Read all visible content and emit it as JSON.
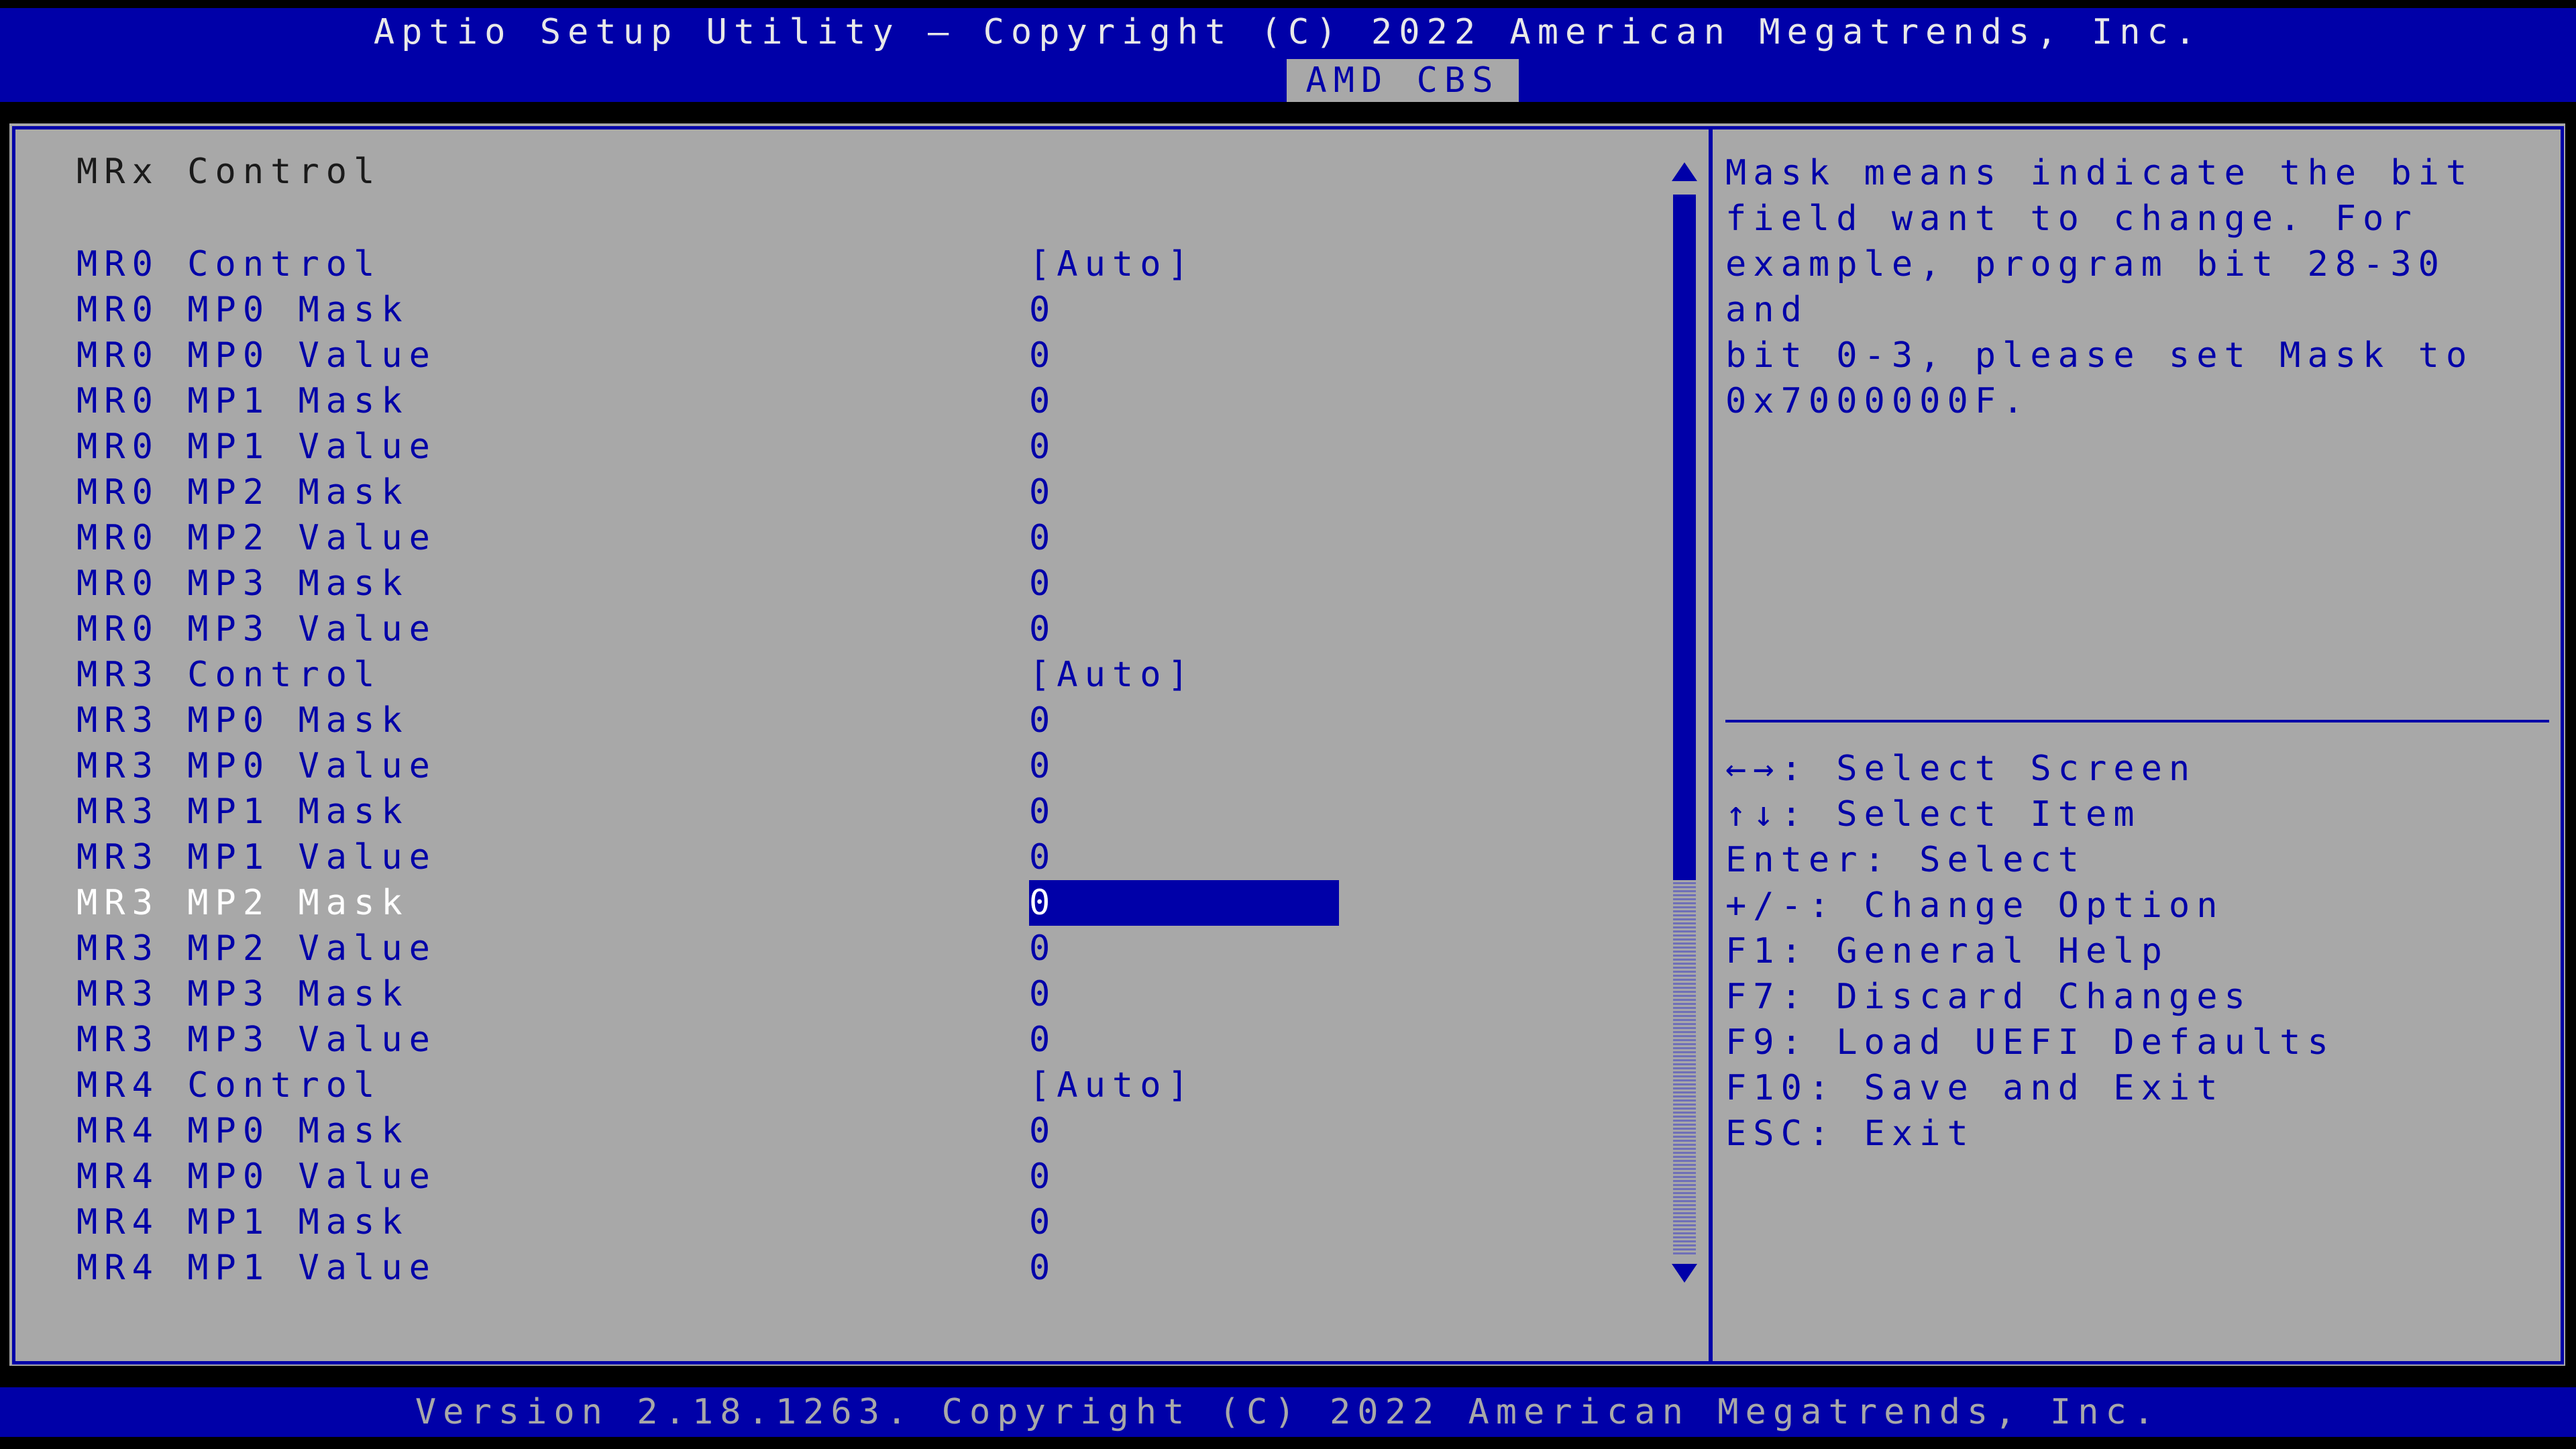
{
  "header": {
    "title": "Aptio Setup Utility – Copyright (C) 2022 American Megatrends, Inc.",
    "active_tab": "AMD CBS"
  },
  "menu": {
    "heading": "MRx Control",
    "items": [
      {
        "label": "MR0 Control",
        "value": "[Auto]"
      },
      {
        "label": "MR0 MP0 Mask",
        "value": "0"
      },
      {
        "label": "MR0 MP0 Value",
        "value": "0"
      },
      {
        "label": "MR0 MP1 Mask",
        "value": "0"
      },
      {
        "label": "MR0 MP1 Value",
        "value": "0"
      },
      {
        "label": "MR0 MP2 Mask",
        "value": "0"
      },
      {
        "label": "MR0 MP2 Value",
        "value": "0"
      },
      {
        "label": "MR0 MP3 Mask",
        "value": "0"
      },
      {
        "label": "MR0 MP3 Value",
        "value": "0"
      },
      {
        "label": "MR3 Control",
        "value": "[Auto]"
      },
      {
        "label": "MR3 MP0 Mask",
        "value": "0"
      },
      {
        "label": "MR3 MP0 Value",
        "value": "0"
      },
      {
        "label": "MR3 MP1 Mask",
        "value": "0"
      },
      {
        "label": "MR3 MP1 Value",
        "value": "0"
      },
      {
        "label": "MR3 MP2 Mask",
        "value": "0"
      },
      {
        "label": "MR3 MP2 Value",
        "value": "0"
      },
      {
        "label": "MR3 MP3 Mask",
        "value": "0"
      },
      {
        "label": "MR3 MP3 Value",
        "value": "0"
      },
      {
        "label": "MR4 Control",
        "value": "[Auto]"
      },
      {
        "label": "MR4 MP0 Mask",
        "value": "0"
      },
      {
        "label": "MR4 MP0 Value",
        "value": "0"
      },
      {
        "label": "MR4 MP1 Mask",
        "value": "0"
      },
      {
        "label": "MR4 MP1 Value",
        "value": "0"
      }
    ]
  },
  "help": {
    "text": "Mask means indicate the bit\nfield want to change. For\nexample, program bit 28-30 and\nbit 0-3, please set Mask to\n0x7000000F.",
    "keys": [
      "←→: Select Screen",
      "↑↓: Select Item",
      "Enter: Select",
      "+/-: Change Option",
      "F1: General Help",
      "F7: Discard Changes",
      "F9: Load UEFI Defaults",
      "F10: Save and Exit",
      "ESC: Exit"
    ]
  },
  "footer": {
    "version": "Version 2.18.1263. Copyright (C) 2022 American Megatrends, Inc."
  },
  "colors": {
    "bios_blue": "#0000a8",
    "panel_gray": "#a8a8a8",
    "highlight_text": "#ffffff"
  }
}
